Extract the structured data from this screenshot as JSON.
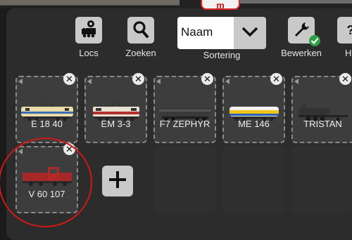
{
  "header": {
    "badge": "m"
  },
  "toolbar": [
    {
      "label": "Locs",
      "icon": "train-icon"
    },
    {
      "label": "Zoeken",
      "icon": "search-icon"
    },
    {
      "label": "Sortering",
      "icon": "chevron-down-icon"
    },
    {
      "label": "Bewerken",
      "icon": "wrench-icon"
    },
    {
      "label": "H",
      "icon": "help-icon"
    }
  ],
  "sort": {
    "value": "Naam"
  },
  "locos": [
    {
      "name": "E 18 40"
    },
    {
      "name": "EM 3-3"
    },
    {
      "name": "F7 ZEPHYR"
    },
    {
      "name": "ME 146"
    },
    {
      "name": "TRISTAN"
    },
    {
      "name": "V 60 107"
    }
  ],
  "add_button": {
    "symbol": "+"
  },
  "colors": {
    "panel": "#2c2c2c",
    "highlight": "#d01818",
    "check": "#2ea043"
  }
}
